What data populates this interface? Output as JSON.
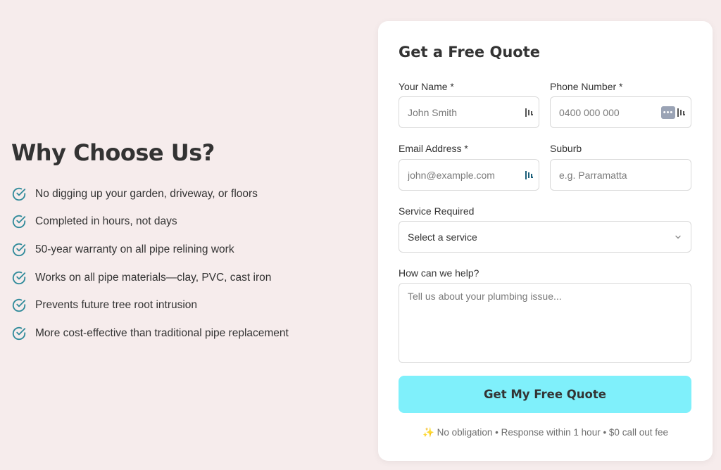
{
  "benefits_section": {
    "title": "Why Choose Us?",
    "items": [
      "No digging up your garden, driveway, or floors",
      "Completed in hours, not days",
      "50-year warranty on all pipe relining work",
      "Works on all pipe materials—clay, PVC, cast iron",
      "Prevents future tree root intrusion",
      "More cost-effective than traditional pipe replacement"
    ],
    "icon": "check-circle-icon",
    "accent_color": "#2f8a9a"
  },
  "form": {
    "title": "Get a Free Quote",
    "name": {
      "label": "Your Name *",
      "placeholder": "John Smith"
    },
    "phone": {
      "label": "Phone Number *",
      "placeholder": "0400 000 000"
    },
    "email": {
      "label": "Email Address *",
      "placeholder": "john@example.com"
    },
    "suburb": {
      "label": "Suburb",
      "placeholder": "e.g. Parramatta"
    },
    "service": {
      "label": "Service Required",
      "selected": "Select a service"
    },
    "message": {
      "label": "How can we help?",
      "placeholder": "Tell us about your plumbing issue..."
    },
    "submit_label": "Get My Free Quote",
    "submit_color": "#7ff0fb",
    "footnote_icon": "✨",
    "footnote": "No obligation • Response within 1 hour • $0 call out fee"
  }
}
